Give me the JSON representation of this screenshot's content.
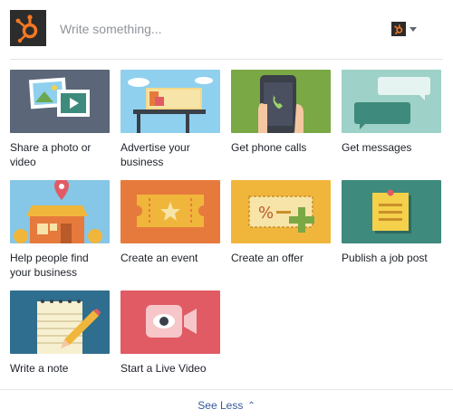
{
  "composer": {
    "placeholder": "Write something...",
    "logo_icon": "hubspot-sprocket-icon",
    "account_icon": "hubspot-page-avatar-icon",
    "dropdown_icon": "caret-down-icon"
  },
  "tiles": [
    {
      "label": "Share a photo or video",
      "icon": "photo-video-icon",
      "bg": "#5b6678"
    },
    {
      "label": "Advertise your business",
      "icon": "billboard-icon",
      "bg": "#8fd0ee"
    },
    {
      "label": "Get phone calls",
      "icon": "phone-call-icon",
      "bg": "#7aa845"
    },
    {
      "label": "Get messages",
      "icon": "message-bubbles-icon",
      "bg": "#9ed1c7"
    },
    {
      "label": "Help people find your business",
      "icon": "storefront-pin-icon",
      "bg": "#86c6e6"
    },
    {
      "label": "Create an event",
      "icon": "event-ticket-icon",
      "bg": "#e67a3c"
    },
    {
      "label": "Create an offer",
      "icon": "offer-coupon-icon",
      "bg": "#f0b63b"
    },
    {
      "label": "Publish a job post",
      "icon": "job-post-note-icon",
      "bg": "#3e8a7c"
    },
    {
      "label": "Write a note",
      "icon": "note-pencil-icon",
      "bg": "#2f6e8e"
    },
    {
      "label": "Start a Live Video",
      "icon": "live-video-camera-icon",
      "bg": "#e05b64"
    }
  ],
  "footer": {
    "see_less_label": "See Less",
    "chevron_icon": "chevron-up-icon"
  },
  "colors": {
    "link": "#365899",
    "hubspot_orange": "#f57722"
  }
}
